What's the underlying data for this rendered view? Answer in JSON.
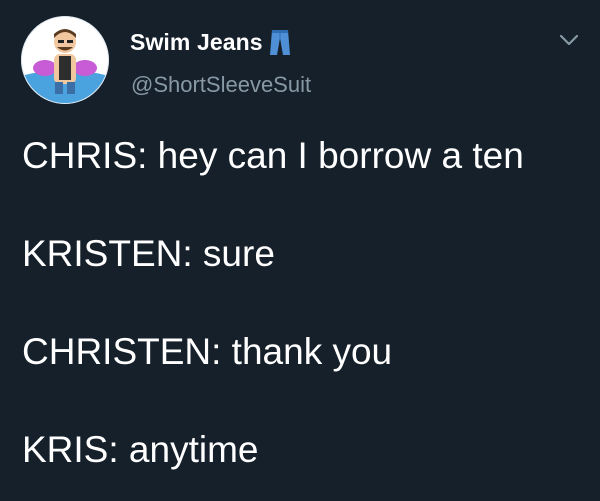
{
  "author": {
    "display_name": "Swim Jeans",
    "display_name_emoji": "jeans-emoji",
    "handle": "@ShortSleeveSuit",
    "avatar_icon": "cartoon-man-avatar-icon"
  },
  "menu": {
    "icon": "chevron-down-icon"
  },
  "tweet": {
    "lines": [
      "CHRIS: hey can I borrow a ten",
      "KRISTEN: sure",
      "CHRISTEN: thank you",
      "KRIS: anytime"
    ]
  },
  "colors": {
    "background": "#15202b",
    "text": "#ffffff",
    "secondary_text": "#8899a6"
  }
}
